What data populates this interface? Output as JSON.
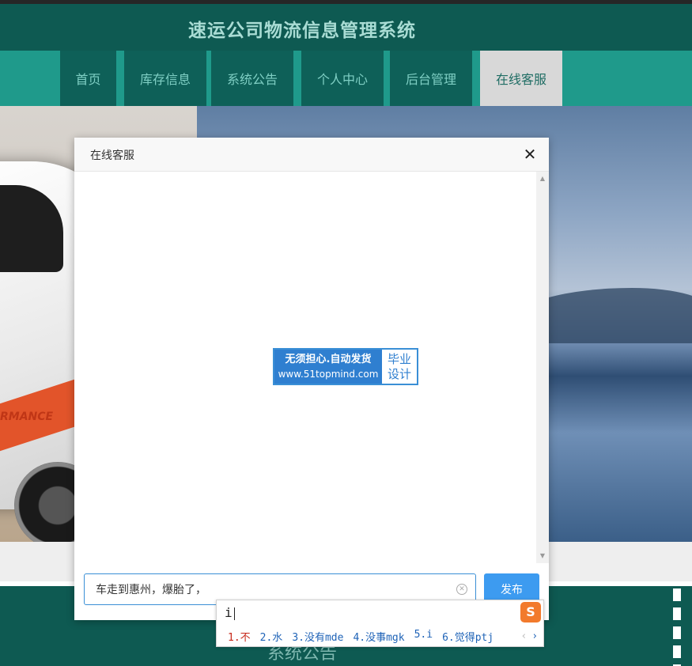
{
  "site": {
    "title": "速运公司物流信息管理系统"
  },
  "nav": [
    {
      "label": "首页",
      "active": false
    },
    {
      "label": "库存信息",
      "active": false
    },
    {
      "label": "系统公告",
      "active": false
    },
    {
      "label": "个人中心",
      "active": false
    },
    {
      "label": "后台管理",
      "active": false
    },
    {
      "label": "在线客服",
      "active": true
    }
  ],
  "banner": {
    "car_text": "RMANCE"
  },
  "lower": {
    "section_title": "系统公告"
  },
  "modal": {
    "title": "在线客服",
    "close_symbol": "✕",
    "watermark": {
      "line1": "无须担心.自动发货",
      "line2": "www.51topmind.com",
      "right_top": "毕业",
      "right_bottom": "设计"
    },
    "input_value": "车走到惠州，爆胎了，",
    "send_label": "发布"
  },
  "ime": {
    "composition": "i",
    "logo": "S",
    "candidates": [
      "1.不",
      "2.水",
      "3.没有mde",
      "4.没事mgk",
      "5.i",
      "6.觉得ptj"
    ],
    "prev": "‹",
    "next": "›"
  },
  "colors": {
    "header": "#0e5a52",
    "nav": "#1f9a8b",
    "accent": "#3d9bf0"
  }
}
